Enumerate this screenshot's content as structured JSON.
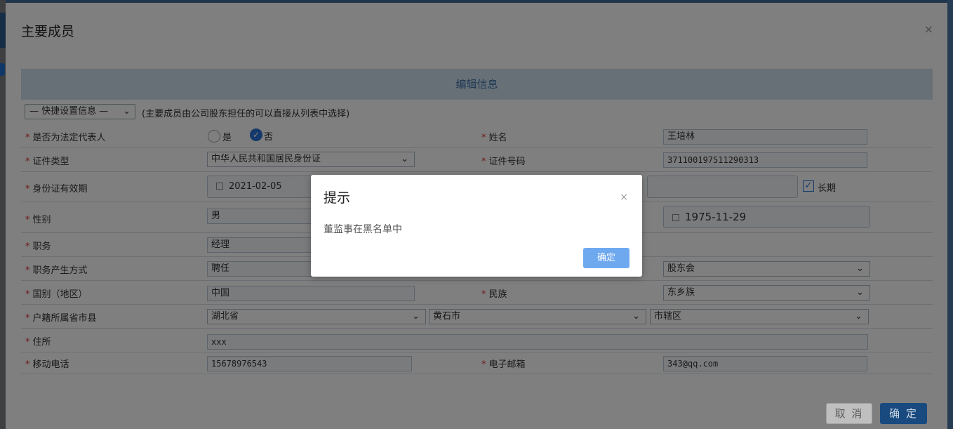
{
  "modal": {
    "title": "主要成员",
    "close": "×",
    "section_title": "编辑信息",
    "quick_select": "— 快捷设置信息 —",
    "quick_hint": "(主要成员由公司股东担任的可以直接从列表中选择)",
    "cancel_label": "取 消",
    "ok_label": "确 定"
  },
  "form": {
    "legal_rep": {
      "label": "是否为法定代表人",
      "yes": "是",
      "no": "否",
      "selected": "否"
    },
    "name": {
      "label": "姓名",
      "value": "王培林"
    },
    "id_type": {
      "label": "证件类型",
      "value": "中华人民共和国居民身份证"
    },
    "id_no": {
      "label": "证件号码",
      "value": "371100197511290313"
    },
    "id_valid": {
      "label": "身份证有效期",
      "start": "2021-02-05",
      "long_term": "长期"
    },
    "gender": {
      "label": "性别",
      "value": "男"
    },
    "birth": {
      "value": "1975-11-29"
    },
    "position": {
      "label": "职务",
      "value": "经理"
    },
    "position_method": {
      "label": "职务产生方式",
      "value": "聘任",
      "right_value": "股东会"
    },
    "country": {
      "label": "国别（地区）",
      "value": "中国"
    },
    "ethnicity": {
      "label": "民族",
      "value": "东乡族"
    },
    "household": {
      "label": "户籍所属省市县",
      "province": "湖北省",
      "city": "黄石市",
      "district": "市辖区"
    },
    "address": {
      "label": "住所",
      "value": "xxx"
    },
    "mobile": {
      "label": "移动电话",
      "value": "15678976543"
    },
    "email": {
      "label": "电子邮箱",
      "value": "343@qq.com"
    }
  },
  "alert": {
    "title": "提示",
    "close": "×",
    "message": "董监事在黑名单中",
    "ok_label": "确定"
  },
  "colors": {
    "accent": "#2f73c7",
    "required": "#d33333",
    "section_bg": "#cfe0ee",
    "alert_button": "#6ea9f0"
  }
}
